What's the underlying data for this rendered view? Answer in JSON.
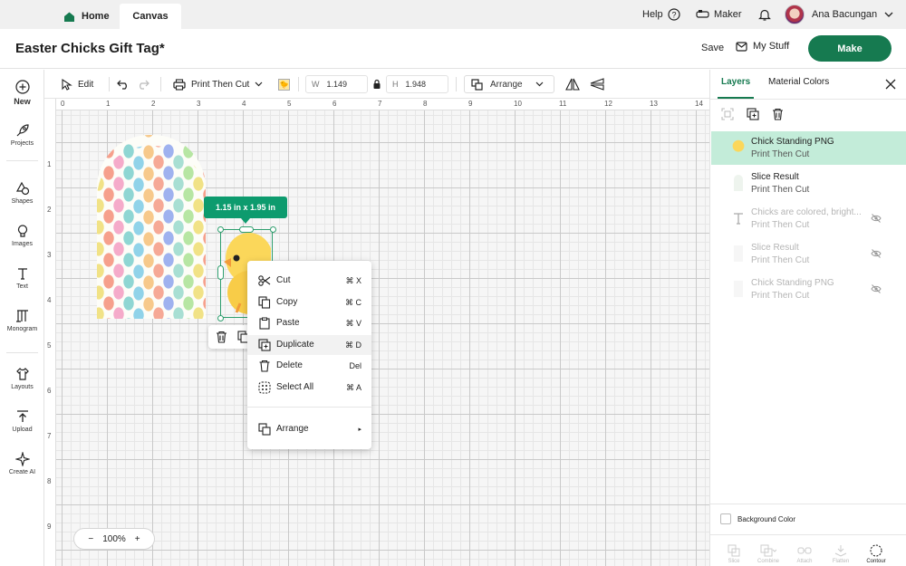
{
  "topbar": {
    "home_label": "Home",
    "canvas_label": "Canvas",
    "help_label": "Help",
    "maker_label": "Maker",
    "user_name": "Ana Bacungan"
  },
  "titlebar": {
    "title": "Easter Chicks Gift Tag*",
    "save_label": "Save",
    "mystuff_label": "My Stuff",
    "make_label": "Make"
  },
  "leftnav": {
    "items": [
      {
        "label": "New",
        "icon": "plus-circle-icon"
      },
      {
        "label": "Projects",
        "icon": "rocket-icon"
      },
      {
        "label": "Shapes",
        "icon": "shapes-icon"
      },
      {
        "label": "Images",
        "icon": "bulb-icon"
      },
      {
        "label": "Text",
        "icon": "text-icon"
      },
      {
        "label": "Monogram",
        "icon": "monogram-icon"
      },
      {
        "label": "Layouts",
        "icon": "shirt-icon"
      },
      {
        "label": "Upload",
        "icon": "upload-icon"
      },
      {
        "label": "Create AI",
        "icon": "sparkle-icon"
      }
    ]
  },
  "toolbar": {
    "edit_label": "Edit",
    "operation_value": "Print Then Cut",
    "w_label": "W",
    "w_value": "1.149",
    "h_label": "H",
    "h_value": "1.948",
    "arrange_label": "Arrange"
  },
  "canvas": {
    "ruler_top": [
      "0",
      "1",
      "2",
      "3",
      "4",
      "5",
      "6",
      "7",
      "8",
      "9",
      "10",
      "11",
      "12",
      "13",
      "14"
    ],
    "ruler_left": [
      "1",
      "2",
      "3",
      "4",
      "5",
      "6",
      "7",
      "8",
      "9"
    ],
    "size_badge": "1.15  in x 1.95  in",
    "zoom_label": "100%",
    "zoom_minus": "−",
    "zoom_plus": "+"
  },
  "context_menu": {
    "items": [
      {
        "label": "Cut",
        "shortcut": "⌘ X",
        "icon": "scissors-icon"
      },
      {
        "label": "Copy",
        "shortcut": "⌘ C",
        "icon": "copy-icon"
      },
      {
        "label": "Paste",
        "shortcut": "⌘ V",
        "icon": "clipboard-icon"
      },
      {
        "label": "Duplicate",
        "shortcut": "⌘ D",
        "icon": "duplicate-icon"
      },
      {
        "label": "Delete",
        "shortcut": "Del",
        "icon": "trash-icon"
      },
      {
        "label": "Select All",
        "shortcut": "⌘ A",
        "icon": "select-all-icon"
      },
      {
        "label": "Arrange",
        "shortcut": "▸",
        "icon": "arrange-icon"
      }
    ]
  },
  "panel": {
    "tab_layers": "Layers",
    "tab_material": "Material Colors",
    "layers": [
      {
        "name": "Chick Standing PNG",
        "sub": "Print Then Cut"
      },
      {
        "name": "Slice Result",
        "sub": "Print Then Cut"
      },
      {
        "name": "Chicks are colored, bright...",
        "sub": "Print Then Cut"
      },
      {
        "name": "Slice Result",
        "sub": "Print Then Cut"
      },
      {
        "name": "Chick Standing PNG",
        "sub": "Print Then Cut"
      }
    ],
    "background_color_label": "Background Color",
    "bottom_tools": [
      "Slice",
      "Combine",
      "Attach",
      "Flatten",
      "Contour"
    ]
  },
  "colors": {
    "accent": "#167a50",
    "selected_layer": "#c3ecd9",
    "badge": "#0d9b6e"
  }
}
